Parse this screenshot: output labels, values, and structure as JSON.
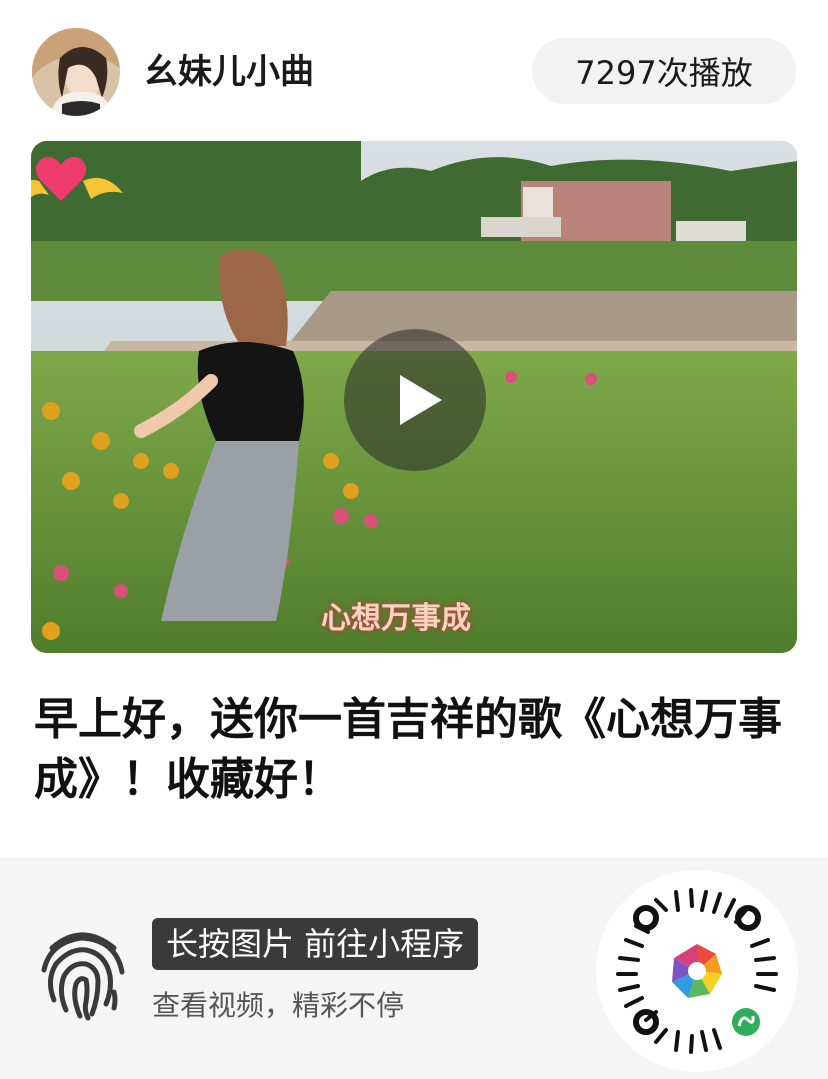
{
  "header": {
    "author_name": "幺妹儿小曲",
    "play_count": "7297次播放"
  },
  "video": {
    "overlay_caption": "心想万事成"
  },
  "post": {
    "title": "早上好，送你一首吉祥的歌《心想万事成》！收藏好！"
  },
  "footer": {
    "action_label": "长按图片 前往小程序",
    "subtitle": "查看视频，精彩不停"
  },
  "icons": {
    "play": "play-icon",
    "fingerprint": "fingerprint-icon",
    "qr": "mini-program-code-icon"
  },
  "colors": {
    "badge_bg": "#3a3a3a",
    "footer_bg": "#f5f5f5",
    "plays_bg": "#f2f2f2"
  }
}
